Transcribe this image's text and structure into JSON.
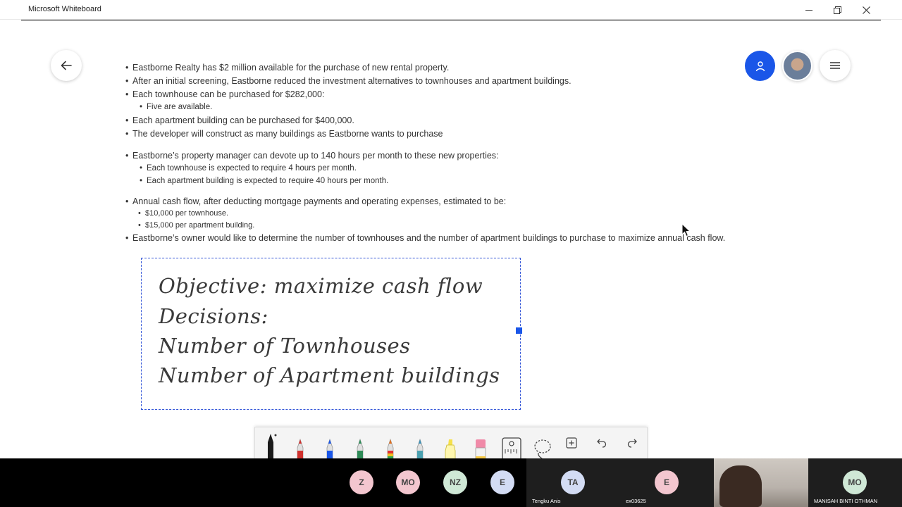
{
  "window": {
    "title": "Microsoft Whiteboard",
    "minimize_icon": "minimize-icon",
    "restore_icon": "restore-icon",
    "close_icon": "close-icon"
  },
  "content": {
    "bullets": [
      {
        "level": 1,
        "text": "Eastborne Realty has $2 million available for the purchase of new rental property."
      },
      {
        "level": 1,
        "text": "After an initial screening, Eastborne reduced the investment alternatives to townhouses and apartment buildings."
      },
      {
        "level": 1,
        "text": "Each townhouse can be purchased for $282,000:"
      },
      {
        "level": 2,
        "text": "Five are available."
      },
      {
        "level": 1,
        "text": "Each apartment building can be purchased for $400,000."
      },
      {
        "level": 1,
        "text": "The developer will construct as many buildings as Eastborne wants to purchase"
      },
      {
        "level": 1,
        "text": "Eastborne’s property manager can devote up to 140 hours per month to these new properties:"
      },
      {
        "level": 2,
        "text": "Each townhouse is expected to require 4 hours per month."
      },
      {
        "level": 2,
        "text": "Each apartment building is expected to require 40 hours per month."
      },
      {
        "level": 1,
        "text": "Annual cash flow, after deducting mortgage payments and operating expenses, estimated to be:"
      },
      {
        "level": 2,
        "text": "$10,000 per townhouse."
      },
      {
        "level": 2,
        "text": "$15,000 per apartment building."
      },
      {
        "level": 1,
        "text": "Eastborne’s owner would like to determine the number of townhouses and the number of apartment buildings to purchase to maximize annual cash flow."
      }
    ]
  },
  "note": {
    "lines": [
      "Objective: maximize cash flow",
      "Decisions:",
      "Number of Townhouses",
      "Number of Apartment buildings"
    ]
  },
  "toolbar": {
    "tools": [
      "pen-black",
      "pen-red",
      "pen-blue",
      "pen-green",
      "pen-rainbow",
      "pen-galaxy",
      "highlighter-yellow",
      "eraser",
      "ruler",
      "lasso",
      "add",
      "undo",
      "redo"
    ],
    "colors": {
      "black": "#1a1a1a",
      "red": "#d0312d",
      "blue": "#1a56e8",
      "green": "#2e8b57",
      "yellow": "#f5e04a",
      "pink": "#f08aa8"
    }
  },
  "meeting": {
    "participants": [
      {
        "initials": "Z",
        "name": "",
        "color": "#f3c6cf"
      },
      {
        "initials": "MO",
        "name": "",
        "color": "#f3c6cf"
      },
      {
        "initials": "NZ",
        "name": "",
        "color": "#cfe8d6"
      },
      {
        "initials": "E",
        "name": "",
        "color": "#d3dcf4"
      },
      {
        "initials": "TA",
        "name": "Tengku Anis",
        "color": "#d3dcf4"
      },
      {
        "initials": "E",
        "name": "ex03625",
        "color": "#f3c6cf"
      },
      {
        "initials": "",
        "name": "",
        "color": ""
      },
      {
        "initials": "MO",
        "name": "MANISAH BINTI OTHMAN",
        "color": "#cfe8d6"
      }
    ]
  },
  "accent_color": "#1a56e8"
}
